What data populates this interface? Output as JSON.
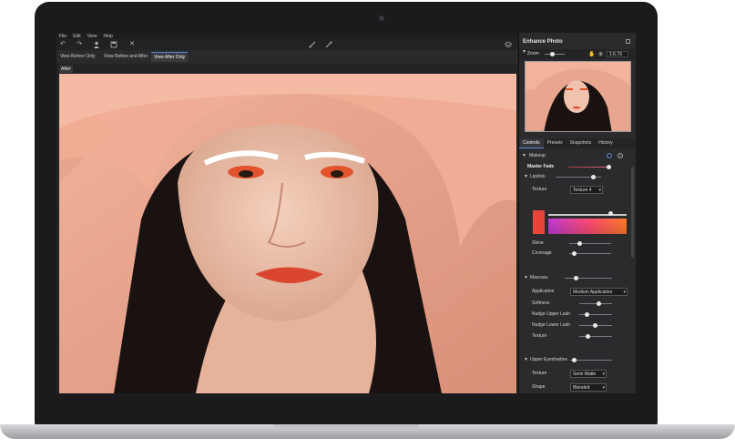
{
  "menu": [
    "File",
    "Edit",
    "View",
    "Help"
  ],
  "view_tabs": [
    "View Before Only",
    "View Before and After",
    "View After Only"
  ],
  "view_active": "View After Only",
  "canvas_label": "After",
  "panel": {
    "title": "Enhance Photo",
    "zoom_label": "Zoom",
    "zoom_value": "1:6.79",
    "tabs": [
      "Controls",
      "Presets",
      "Snapshots",
      "History"
    ],
    "active_tab": "Controls"
  },
  "controls": {
    "makeup": "Makeup",
    "master_fade": "Master Fade",
    "lipstick": "Lipstick",
    "texture": "Texture",
    "texture_value": "Texture 4",
    "shine": "Shine",
    "coverage": "Coverage",
    "mascara": "Mascara",
    "application": "Application",
    "application_value": "Medium Application",
    "softness": "Softness",
    "nudge_upper": "Nudge Upper Lash",
    "nudge_lower": "Nudge Lower Lash",
    "mascara_texture": "Texture",
    "upper_eyeshadow": "Upper Eyeshadow",
    "eyeshadow_texture": "Texture",
    "eyeshadow_texture_value": "Semi Matte",
    "shape": "Shape",
    "shape_value": "Blended"
  },
  "colors": {
    "accent": "#5a8ad8",
    "lipstick_swatch": "#e8453a"
  }
}
